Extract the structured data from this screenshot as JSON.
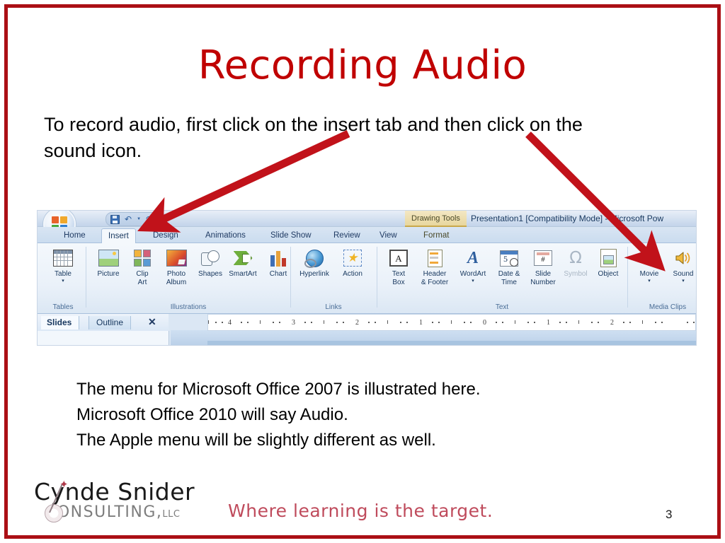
{
  "slide": {
    "title": "Recording Audio",
    "page_number": "3",
    "border_color": "#AB0F15",
    "title_color": "#C00000",
    "intro": "To record audio, first click on the insert tab and then click on the sound icon.",
    "notes": [
      "The menu for Microsoft Office 2007 is illustrated here.",
      "Microsoft Office 2010 will say Audio.",
      "The Apple menu will be slightly different as well."
    ]
  },
  "annotations": {
    "arrow_color": "#C1121A",
    "arrows": [
      {
        "name": "arrow-to-insert-tab",
        "points_to": "Insert tab"
      },
      {
        "name": "arrow-to-sound-button",
        "points_to": "Sound button"
      }
    ]
  },
  "screenshot": {
    "office_orb_label": "Office Button",
    "quick_access": [
      "Save",
      "Undo",
      "Redo",
      "Customize Quick Access Toolbar"
    ],
    "contextual_tab_group": "Drawing Tools",
    "document_title": "Presentation1 [Compatibility Mode] - Microsoft Pow",
    "tabs": [
      {
        "label": "Home",
        "active": false
      },
      {
        "label": "Insert",
        "active": true
      },
      {
        "label": "Design",
        "active": false
      },
      {
        "label": "Animations",
        "active": false
      },
      {
        "label": "Slide Show",
        "active": false
      },
      {
        "label": "Review",
        "active": false
      },
      {
        "label": "View",
        "active": false
      },
      {
        "label": "Format",
        "active": false
      }
    ],
    "groups": [
      {
        "name": "Tables",
        "label": "Tables",
        "buttons": [
          {
            "label": "Table",
            "icon": "table-icon",
            "dropdown": true,
            "disabled": false
          }
        ]
      },
      {
        "name": "Illustrations",
        "label": "Illustrations",
        "buttons": [
          {
            "label": "Picture",
            "icon": "picture-icon",
            "dropdown": false,
            "disabled": false
          },
          {
            "label": "Clip\nArt",
            "icon": "clip-art-icon",
            "dropdown": false,
            "disabled": false
          },
          {
            "label": "Photo\nAlbum",
            "icon": "photo-album-icon",
            "dropdown": true,
            "disabled": false
          },
          {
            "label": "Shapes",
            "icon": "shapes-icon",
            "dropdown": true,
            "disabled": false
          },
          {
            "label": "SmartArt",
            "icon": "smartart-icon",
            "dropdown": false,
            "disabled": false
          },
          {
            "label": "Chart",
            "icon": "chart-icon",
            "dropdown": false,
            "disabled": false
          }
        ]
      },
      {
        "name": "Links",
        "label": "Links",
        "buttons": [
          {
            "label": "Hyperlink",
            "icon": "hyperlink-icon",
            "dropdown": false,
            "disabled": false
          },
          {
            "label": "Action",
            "icon": "action-icon",
            "dropdown": false,
            "disabled": false
          }
        ]
      },
      {
        "name": "Text",
        "label": "Text",
        "buttons": [
          {
            "label": "Text\nBox",
            "icon": "text-box-icon",
            "dropdown": false,
            "disabled": false
          },
          {
            "label": "Header\n& Footer",
            "icon": "header-footer-icon",
            "dropdown": false,
            "disabled": false
          },
          {
            "label": "WordArt",
            "icon": "wordart-icon",
            "dropdown": true,
            "disabled": false
          },
          {
            "label": "Date &\nTime",
            "icon": "date-time-icon",
            "dropdown": false,
            "disabled": false
          },
          {
            "label": "Slide\nNumber",
            "icon": "slide-number-icon",
            "dropdown": false,
            "disabled": false
          },
          {
            "label": "Symbol",
            "icon": "symbol-icon",
            "dropdown": false,
            "disabled": true
          },
          {
            "label": "Object",
            "icon": "object-icon",
            "dropdown": false,
            "disabled": false
          }
        ]
      },
      {
        "name": "MediaClips",
        "label": "Media Clips",
        "buttons": [
          {
            "label": "Movie",
            "icon": "movie-icon",
            "dropdown": true,
            "disabled": false
          },
          {
            "label": "Sound",
            "icon": "sound-icon",
            "dropdown": true,
            "disabled": false
          }
        ]
      }
    ],
    "pane_tabs": [
      {
        "label": "Slides",
        "active": true
      },
      {
        "label": "Outline",
        "active": false
      }
    ],
    "pane_close_label": "✕",
    "ruler_ticks": [
      "4",
      "3",
      "2",
      "1",
      "0",
      "1",
      "2"
    ]
  },
  "footer": {
    "logo_name": "Cynde Snider",
    "logo_sub": "CONSULTING,",
    "logo_sub_small": "LLC",
    "tagline": "Where learning is the target.",
    "tagline_color": "#BF4B5C"
  }
}
